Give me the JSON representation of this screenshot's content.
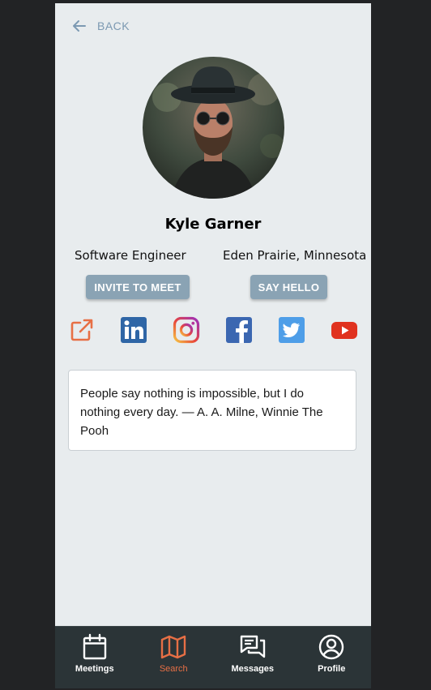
{
  "header": {
    "back_label": "BACK"
  },
  "profile": {
    "name": "Kyle Garner",
    "title": "Software Engineer",
    "location": "Eden Prairie, Minnesota",
    "quote": "People say nothing is impossible, but I do nothing every day. — A. A. Milne, Winnie The Pooh"
  },
  "actions": {
    "invite_label": "INVITE TO MEET",
    "hello_label": "SAY HELLO"
  },
  "social_links": [
    "external-link-icon",
    "linkedin-icon",
    "instagram-icon",
    "facebook-icon",
    "twitter-icon",
    "youtube-icon"
  ],
  "tabs": [
    {
      "label": "Meetings",
      "icon": "calendar-icon"
    },
    {
      "label": "Search",
      "icon": "map-icon",
      "active": true
    },
    {
      "label": "Messages",
      "icon": "messages-icon"
    },
    {
      "label": "Profile",
      "icon": "profile-icon"
    }
  ],
  "colors": {
    "accent": "#e76f45",
    "button": "#8aa3b4",
    "tabbar": "#2b3437",
    "background": "#e8ecee"
  }
}
